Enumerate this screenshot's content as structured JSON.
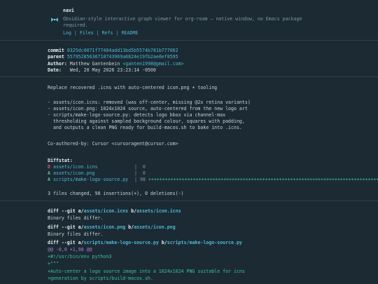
{
  "header": {
    "repo_name": "navi",
    "description_line1": "Obsidian-style interactive graph viewer for org-roam — native window, no Emacs package",
    "description_line2": "required.",
    "nav": [
      "Log",
      "Files",
      "Refs",
      "README"
    ]
  },
  "commit": {
    "commit_label": "commit",
    "commit_hash": "0325dc0071f77404add13bd5b5574b781b777062",
    "parent_label": "parent",
    "parent_hash": "55795285636710743969a6824e19fb2ae0ef8595",
    "author_label": "Author:",
    "author_name": "Matthew Gantenbein",
    "author_email": "<ganten1998@gmail.com>",
    "date_label": "Date:",
    "date_value": "Wed, 20 May 2026 23:23:14 -0500",
    "subject": "Replace recovered .icns with auto-centered icon.png + tooling",
    "body": [
      "- assets/icon.icns: removed (was off-center, missing @2x retina variants)",
      "- assets/icon.png: 1024x1024 source, auto-centered from the new logo art",
      "- scripts/make-logo-source.py: detects logo bbox via channel-max",
      "  thresholding against sampled background colour, squares with padding,",
      "  and outputs a clean PNG ready for build-macos.sh to bake into .icns."
    ],
    "coauthor": "Co-authored-by: Cursor <cursoragent@cursor.com>"
  },
  "diffstat": {
    "title": "Diffstat:",
    "files": [
      {
        "status": "D",
        "path": "assets/icon.icns",
        "count": "0",
        "plus": ""
      },
      {
        "status": "A",
        "path": "assets/icon.png",
        "count": "0",
        "plus": ""
      },
      {
        "status": "A",
        "path": "scripts/make-logo-source.py",
        "count": "98",
        "plus": "++++++++++++++++++++++++++++++++++++++++++++++++++++++++++++++++++++++++++++++++++++++++++++++++++"
      }
    ],
    "summary": "3 files changed, 98 insertions(+), 0 deletions(-)"
  },
  "diff": {
    "blocks": [
      {
        "prefix": "diff --git a/",
        "a": "assets/icon.icns",
        "mid": " b/",
        "b": "assets/icon.icns",
        "note": "Binary files differ."
      },
      {
        "prefix": "diff --git a/",
        "a": "assets/icon.png",
        "mid": " b/",
        "b": "assets/icon.png",
        "note": "Binary files differ."
      },
      {
        "prefix": "diff --git a/",
        "a": "scripts/make-logo-source.py",
        "mid": " b/",
        "b": "scripts/make-logo-source.py",
        "note": ""
      }
    ],
    "hunk": "@@ -0,0 +1,98 @@",
    "added_lines": [
      "+#!/usr/bin/env python3",
      "+\"\"\"",
      "+Auto-center a logo source image into a 1024x1024 PNG suitable for icns",
      "+generation by scripts/build-macos.sh."
    ]
  },
  "colors": {
    "background": "#1b2a33",
    "link": "#4fb7d6",
    "deleted": "#e0566b",
    "added": "#54c38a",
    "hunk": "#b07fd6"
  },
  "icons": {
    "logo": "navi-logo-icon"
  }
}
